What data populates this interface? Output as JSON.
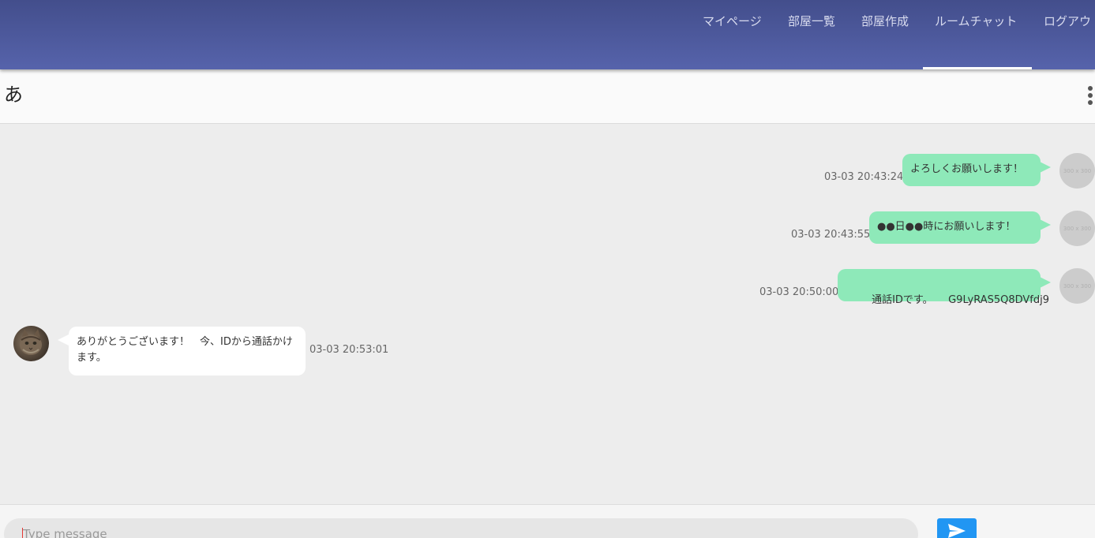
{
  "nav": {
    "items": [
      {
        "label": "マイページ"
      },
      {
        "label": "部屋一覧"
      },
      {
        "label": "部屋作成"
      },
      {
        "label": "ルームチャット"
      },
      {
        "label": "ログアウ"
      }
    ],
    "active_index": 3
  },
  "room": {
    "title": "あ",
    "menu_icon": "more-vert-icon"
  },
  "messages": [
    {
      "side": "me",
      "text": "よろしくお願いします！",
      "time": "03-03 20:43:24",
      "avatar": "300 x 300"
    },
    {
      "side": "me",
      "text": "●●日●●時にお願いします！",
      "time": "03-03 20:43:55",
      "avatar": "300 x 300"
    },
    {
      "side": "me",
      "text": "通話IDです。　　G9LyRAS5Q8DVfdj9",
      "time": "03-03 20:50:00",
      "avatar": "300 x 300"
    },
    {
      "side": "other",
      "text": "ありがとうございます！　今、IDから通話かけます。",
      "time": "03-03 20:53:01",
      "avatar": "cat-photo"
    }
  ],
  "composer": {
    "placeholder": "Type message",
    "send_icon": "send-icon"
  },
  "colors": {
    "header_top": "#434e8c",
    "header_bottom": "#5663ab",
    "my_bubble": "#8ee9b9",
    "other_bubble": "#ffffff",
    "send_button": "#2196f3"
  }
}
